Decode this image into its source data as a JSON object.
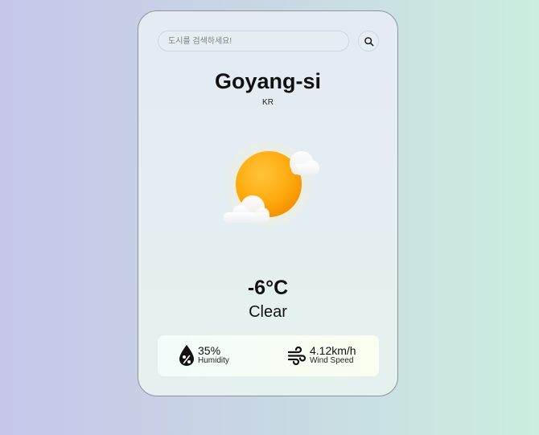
{
  "search": {
    "placeholder": "도시를 검색하세요!",
    "button_icon": "search-icon"
  },
  "location": {
    "city": "Goyang-si",
    "country": "KR"
  },
  "weather": {
    "icon": "sun-with-clouds-icon",
    "temperature": "-6°C",
    "condition": "Clear"
  },
  "stats": {
    "humidity": {
      "icon": "humidity-drop-icon",
      "value": "35%",
      "label": "Humidity"
    },
    "wind": {
      "icon": "wind-icon",
      "value": "4.12km/h",
      "label": "Wind Speed"
    }
  },
  "colors": {
    "sun": "#ffa90a",
    "text": "#111111"
  }
}
